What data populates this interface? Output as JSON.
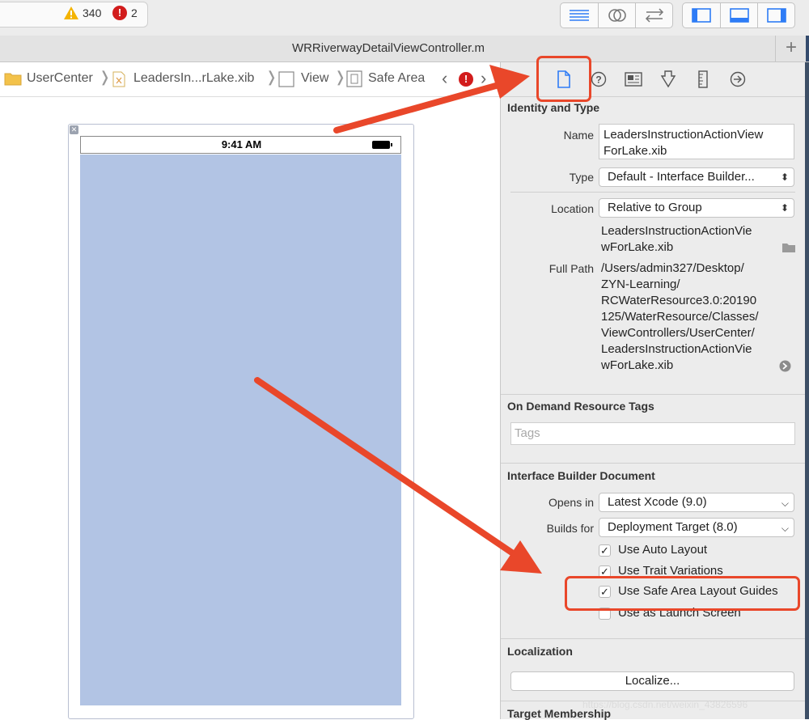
{
  "toolbar": {
    "warnings_count": "340",
    "errors_count": "2",
    "error_glyph": "!"
  },
  "tab": {
    "title": "WRRiverwayDetailViewController.m",
    "add_label": "+"
  },
  "jumpbar": {
    "crumbs": [
      "UserCenter",
      "LeadersIn...rLake.xib",
      "View",
      "Safe Area"
    ]
  },
  "canvas": {
    "time": "9:41 AM",
    "view_color": "#b2c4e4"
  },
  "inspector": {
    "identity": {
      "title": "Identity and Type",
      "name_label": "Name",
      "name_value_1": "LeadersInstructionActionView",
      "name_value_2": "ForLake.xib",
      "type_label": "Type",
      "type_value": "Default - Interface Builder...",
      "location_label": "Location",
      "location_value": "Relative to Group",
      "relative_1": "LeadersInstructionActionVie",
      "relative_2": "wForLake.xib",
      "fullpath_label": "Full Path",
      "fullpath_lines": [
        "/Users/admin327/Desktop/",
        "ZYN-Learning/",
        "RCWaterResource3.0:20190",
        "125/WaterResource/Classes/",
        "ViewControllers/UserCenter/",
        "LeadersInstructionActionVie",
        "wForLake.xib"
      ]
    },
    "on_demand": {
      "title": "On Demand Resource Tags",
      "tags_placeholder": "Tags"
    },
    "ib_document": {
      "title": "Interface Builder Document",
      "opens_in_label": "Opens in",
      "opens_in_value": "Latest Xcode (9.0)",
      "builds_for_label": "Builds for",
      "builds_for_value": "Deployment Target (8.0)",
      "options": [
        {
          "label": "Use Auto Layout",
          "checked": true
        },
        {
          "label": "Use Trait Variations",
          "checked": true
        },
        {
          "label": "Use Safe Area Layout Guides",
          "checked": true
        },
        {
          "label": "Use as Launch Screen",
          "checked": false
        }
      ]
    },
    "localization": {
      "title": "Localization",
      "button": "Localize..."
    },
    "target_membership": {
      "title": "Target Membership"
    }
  },
  "watermark": "https://blog.csdn.net/weixin_43826596",
  "colors": {
    "annotation": "#e9472a",
    "accent": "#2e7cf6"
  }
}
